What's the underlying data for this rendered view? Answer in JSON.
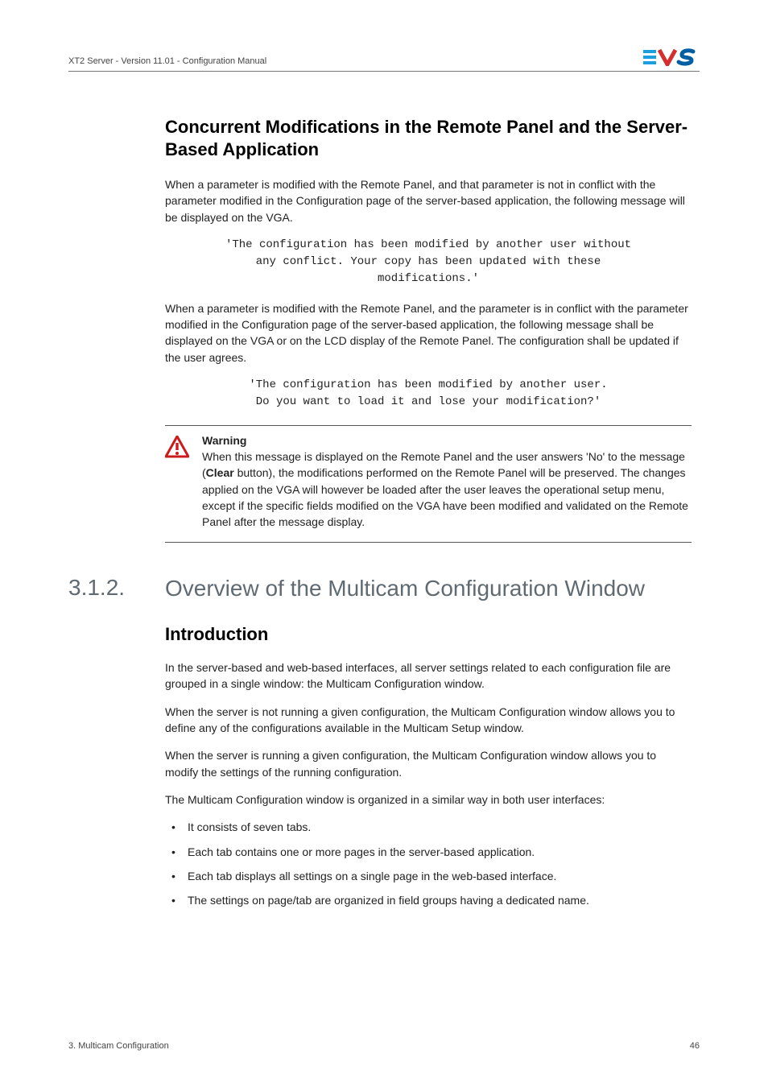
{
  "header": {
    "left": "XT2 Server - Version 11.01 - Configuration Manual"
  },
  "h2_1": "Concurrent Modifications in the Remote Panel and the Server-Based Application",
  "p1": "When a parameter is modified with the Remote Panel, and that parameter is not in conflict with the parameter modified in the Configuration page of the server-based application, the following message will be displayed on the VGA.",
  "code1": "'The configuration has been modified by another user without\nany conflict. Your copy has been updated with these\nmodifications.'",
  "p2": "When a parameter is modified with the Remote Panel, and the parameter is in conflict with the parameter modified in the Configuration page of the server-based application, the following message shall be displayed on the VGA or on the LCD display of the Remote Panel. The configuration shall be updated if the user agrees.",
  "code2": "'The configuration has been modified by another user.\nDo you want to load it and lose your modification?'",
  "warning": {
    "title": "Warning",
    "text_before": "When this message is displayed on the Remote Panel and the user answers 'No' to the message (",
    "bold": "Clear",
    "text_after": " button), the modifications performed on the Remote Panel will be preserved. The changes applied on the VGA will however be loaded after the user leaves the operational setup menu, except if the specific fields modified on the VGA have been modified and validated on the Remote Panel after the message display."
  },
  "section": {
    "number": "3.1.2.",
    "title": "Overview of the Multicam Configuration Window"
  },
  "h3_1": "Introduction",
  "p3": "In the server-based and web-based interfaces, all server settings related to each configuration file are grouped in a single window: the Multicam Configuration window.",
  "p4": "When the server is not running a given configuration, the Multicam Configuration window allows you to define any of the configurations available in the Multicam Setup window.",
  "p5": "When the server is running a given configuration, the Multicam Configuration window allows you to modify the settings of the running configuration.",
  "p6": "The Multicam Configuration window is organized in a similar way in both user interfaces:",
  "bullets": [
    "It consists of seven tabs.",
    "Each tab contains one or more pages in the server-based application.",
    "Each tab displays all settings on a single page in the web-based interface.",
    "The settings on page/tab are organized in field groups having a dedicated name."
  ],
  "footer": {
    "left": "3. Multicam Configuration",
    "right": "46"
  }
}
